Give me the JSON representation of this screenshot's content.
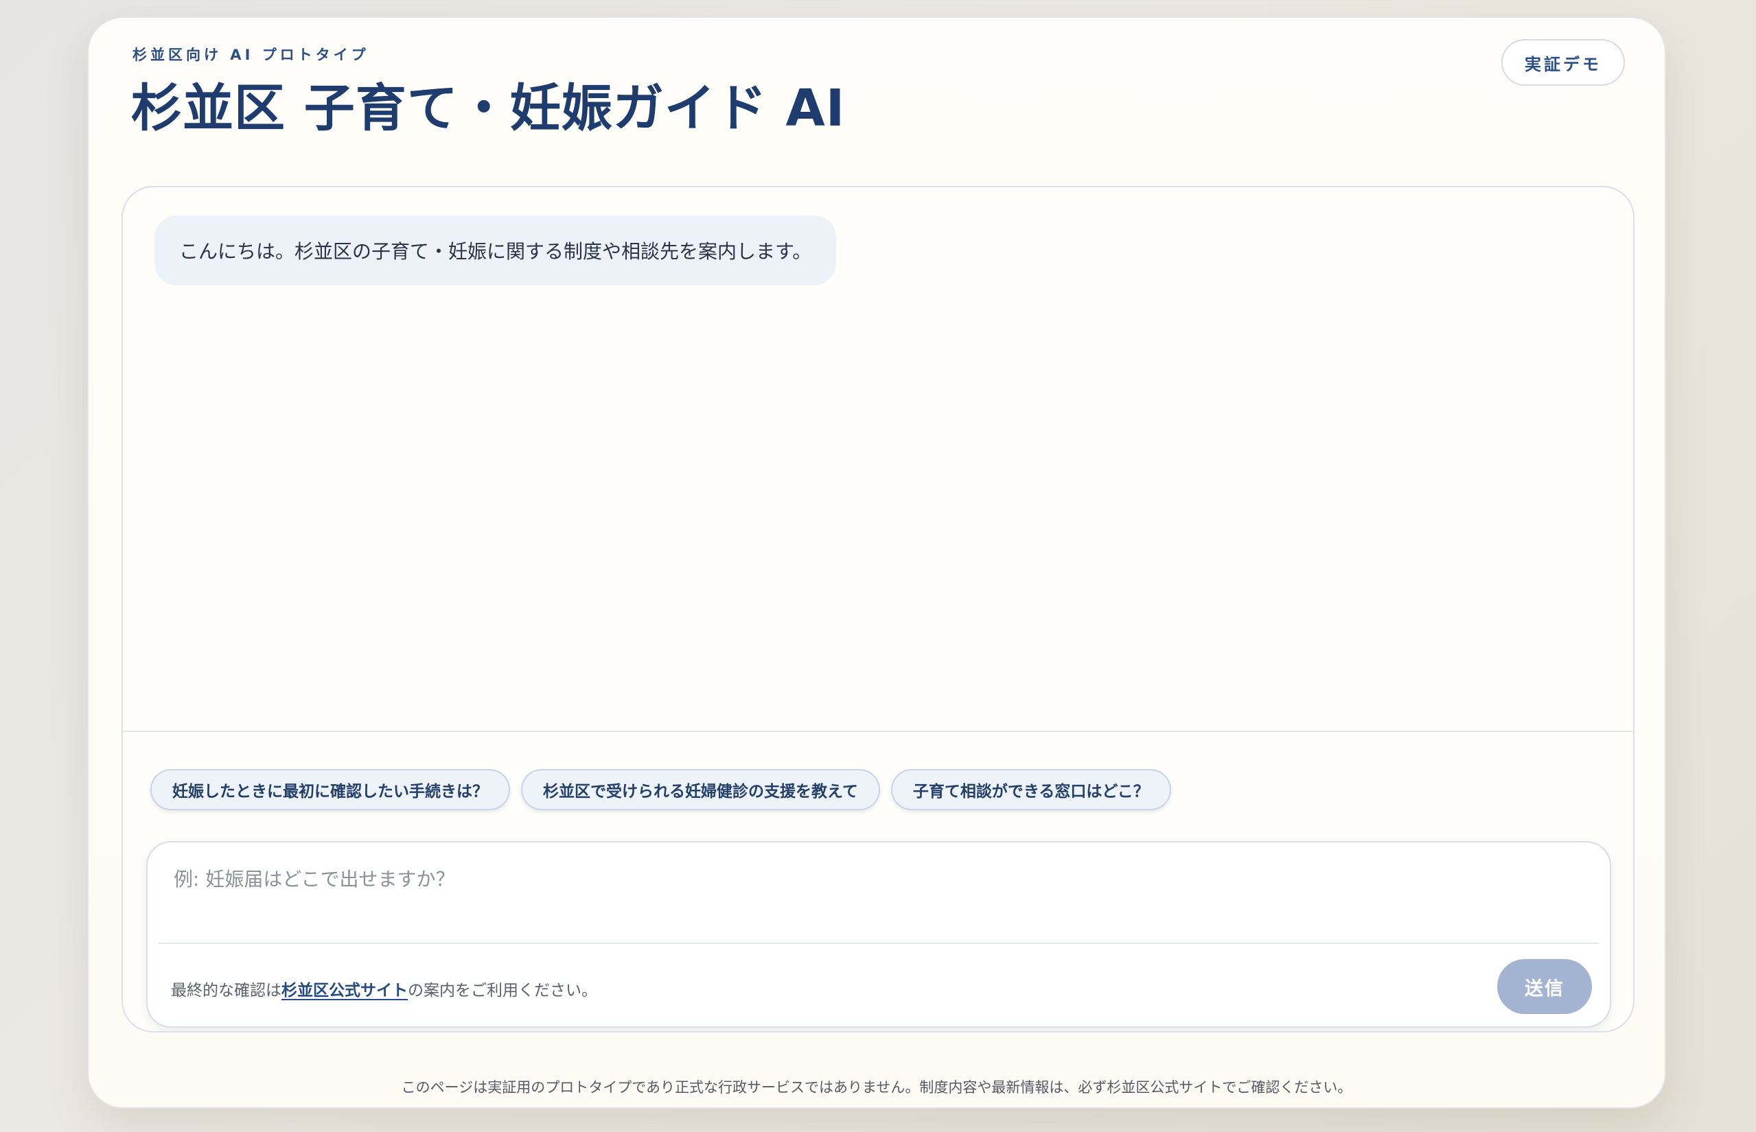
{
  "header": {
    "eyebrow": "杉並区向け AI プロトタイプ",
    "title": "杉並区 子育て・妊娠ガイド AI",
    "badge": "実証デモ"
  },
  "chat": {
    "messages": [
      {
        "role": "assistant",
        "text": "こんにちは。杉並区の子育て・妊娠に関する制度や相談先を案内します。"
      }
    ],
    "suggestions": [
      "妊娠したときに最初に確認したい手続きは？",
      "杉並区で受けられる妊婦健診の支援を教えて",
      "子育て相談ができる窓口はどこ？"
    ]
  },
  "composer": {
    "placeholder": "例: 妊娠届はどこで出せますか？",
    "value": "",
    "notice_prefix": "最終的な確認は",
    "notice_link": "杉並区公式サイト",
    "notice_suffix": "の案内をご利用ください。",
    "send_label": "送信"
  },
  "footer": {
    "disclaimer": "このページは実証用のプロトタイプであり正式な行政サービスではありません。制度内容や最新情報は、必ず杉並区公式サイトでご確認ください。"
  },
  "colors": {
    "primary_navy": "#1e3c6d",
    "accent_blue": "#2a4f86",
    "bubble_bg": "#edf2f8",
    "send_disabled": "#a3b4d2"
  }
}
